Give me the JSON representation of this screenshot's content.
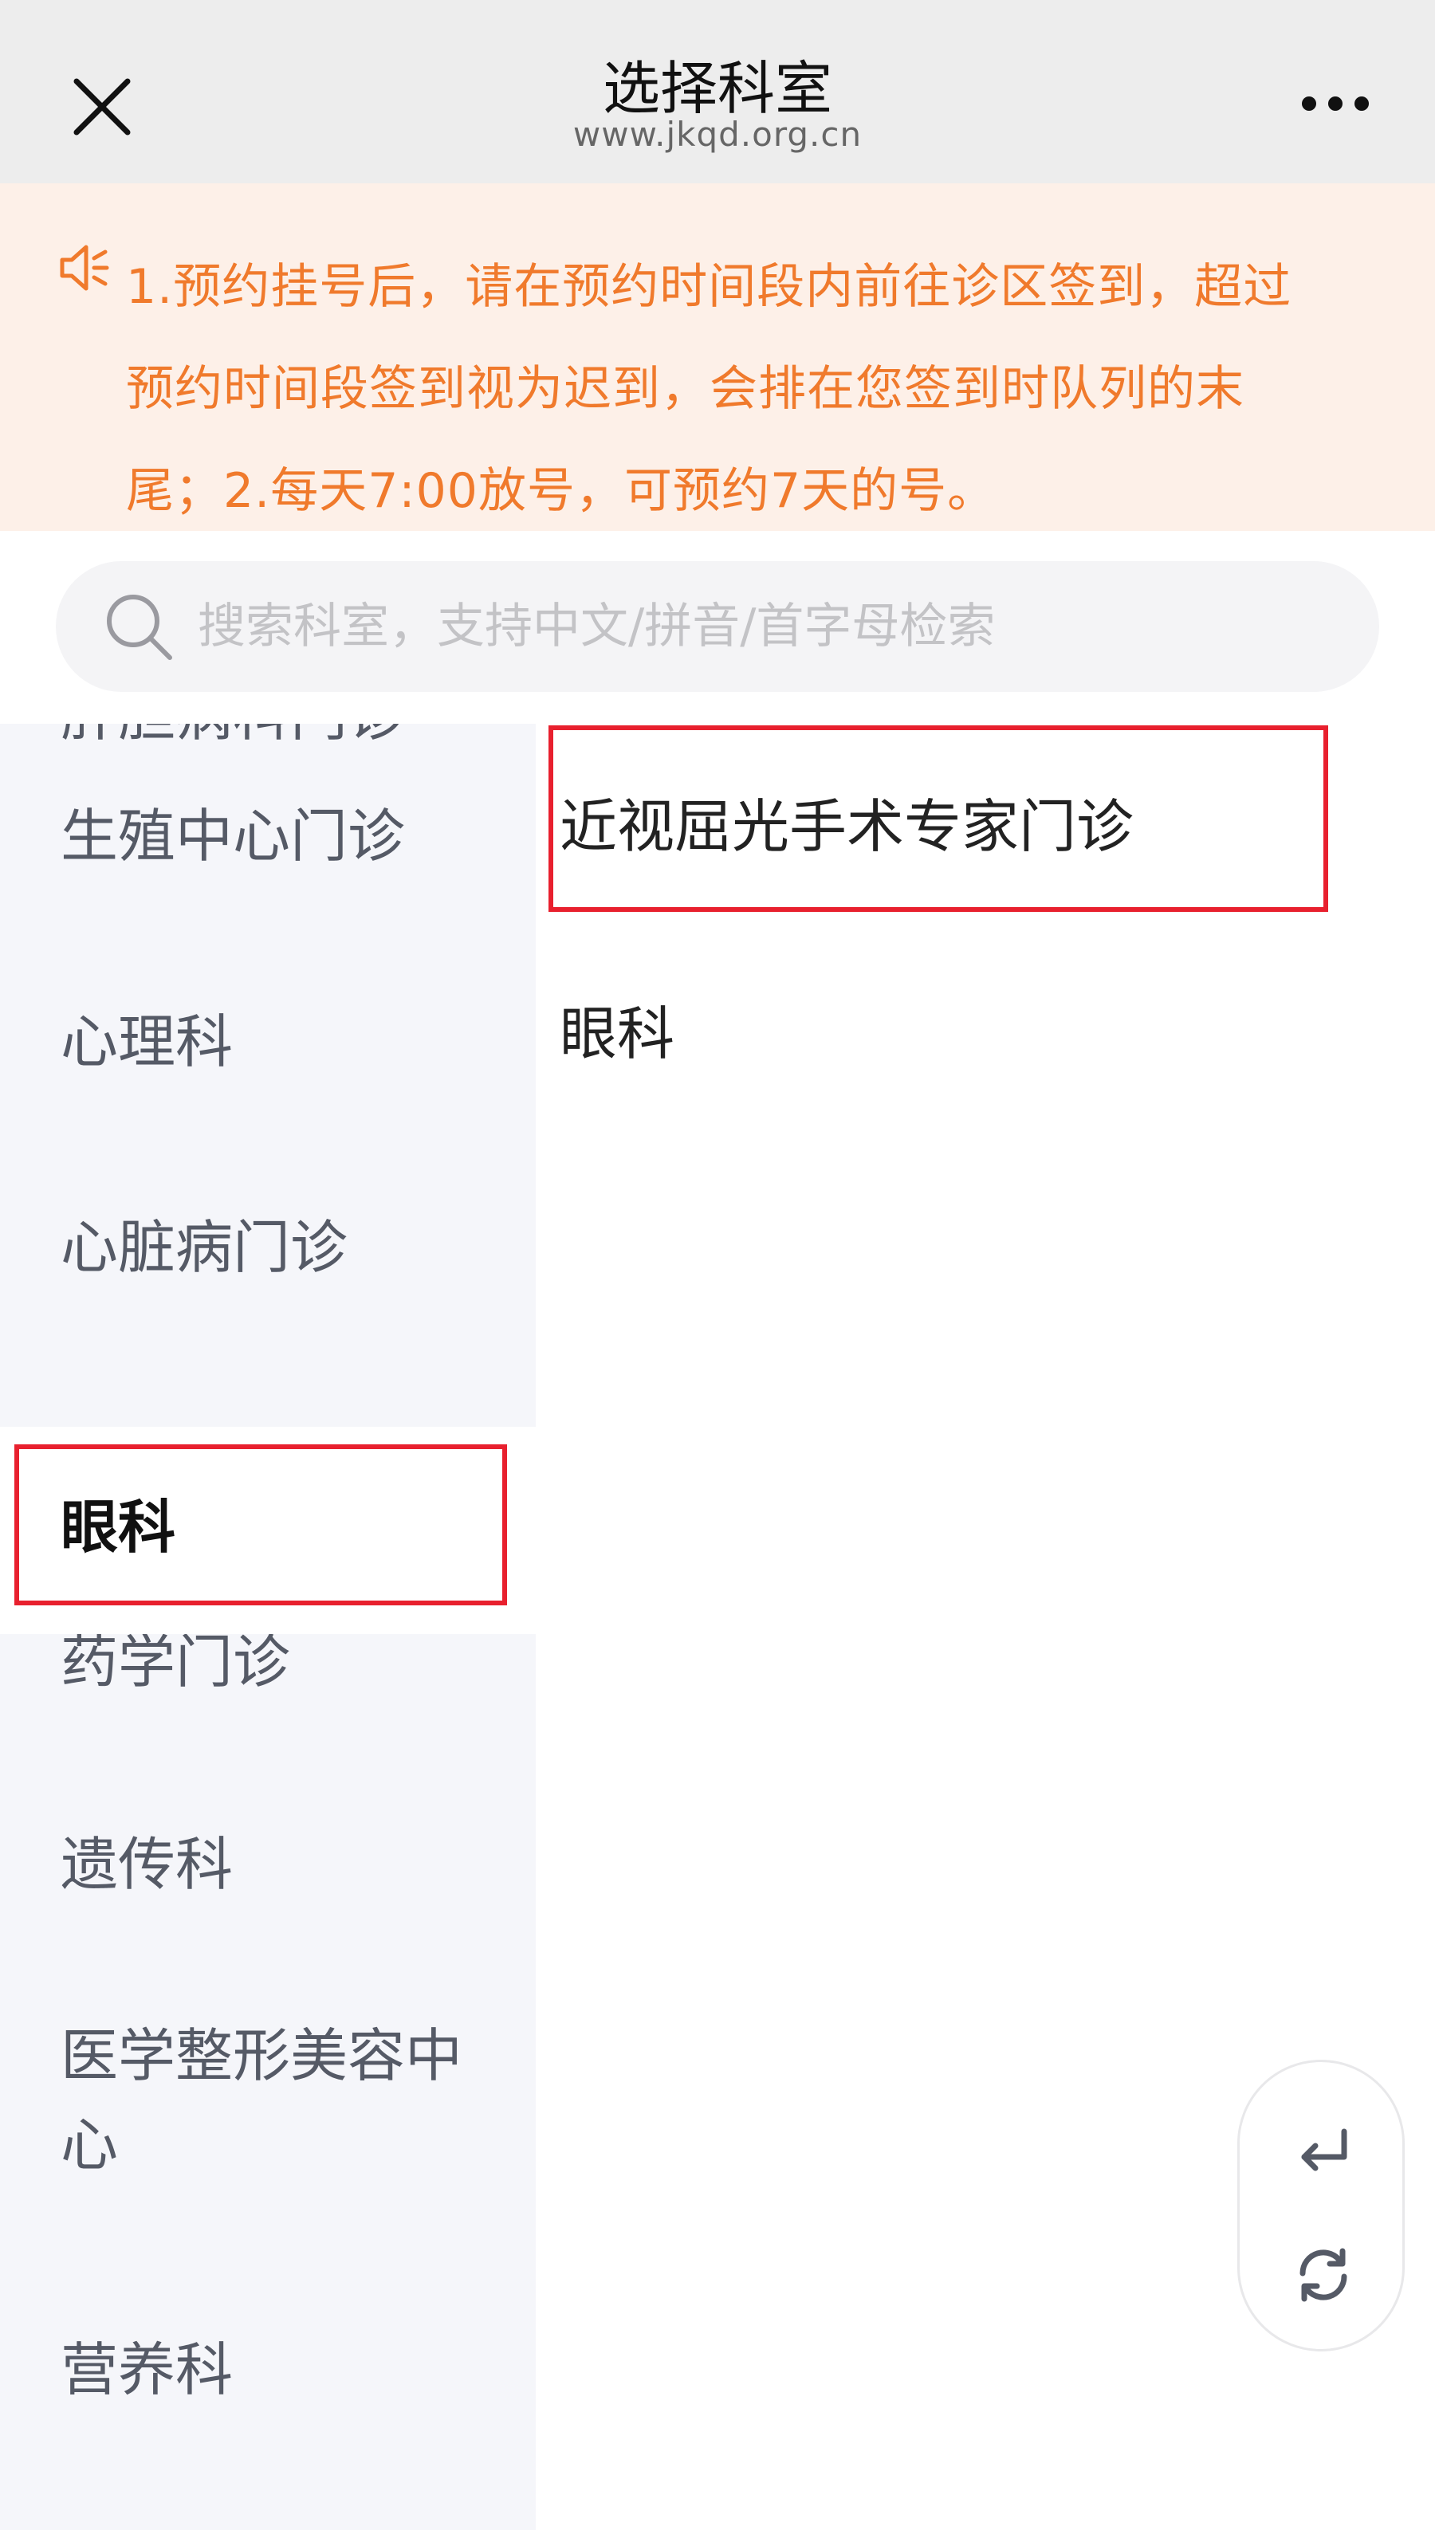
{
  "navbar": {
    "title": "选择科室",
    "subtitle": "www.jkqd.org.cn",
    "close_icon": "close-icon",
    "more_icon": "more-icon"
  },
  "notice": {
    "icon": "speaker-icon",
    "lines": [
      "1.预约挂号后，请在预约时间段内前往诊区签到，超过",
      "预约时间段签到视为迟到，会排在您签到时队列的末",
      "尾；2.每天7:00放号，可预约7天的号。"
    ],
    "color": "#f07a2c",
    "background": "#fdf0e8"
  },
  "search": {
    "placeholder": "搜索科室，支持中文/拼音/首字母检索",
    "icon": "search-icon"
  },
  "departments": {
    "partial_top": "肝胆病科门诊",
    "items": [
      {
        "label": "生殖中心门诊",
        "selected": false
      },
      {
        "label": "心理科",
        "selected": false
      },
      {
        "label": "心脏病门诊",
        "selected": false
      },
      {
        "label": "眼科",
        "selected": true
      },
      {
        "label": "药学门诊",
        "selected": false
      },
      {
        "label": "遗传科",
        "selected": false
      },
      {
        "label": "医学整形美容中心",
        "selected": false
      },
      {
        "label": "营养科",
        "selected": false
      }
    ]
  },
  "sub_departments": {
    "items": [
      {
        "label": "近视屈光手术专家门诊",
        "highlighted": true
      },
      {
        "label": "眼科",
        "highlighted": false
      }
    ]
  },
  "floating": {
    "back_icon": "return-arrow-icon",
    "refresh_icon": "refresh-icon"
  },
  "colors": {
    "highlight_border": "#e8202e",
    "left_panel_bg": "#f5f6fa",
    "navbar_bg": "#ededed"
  }
}
